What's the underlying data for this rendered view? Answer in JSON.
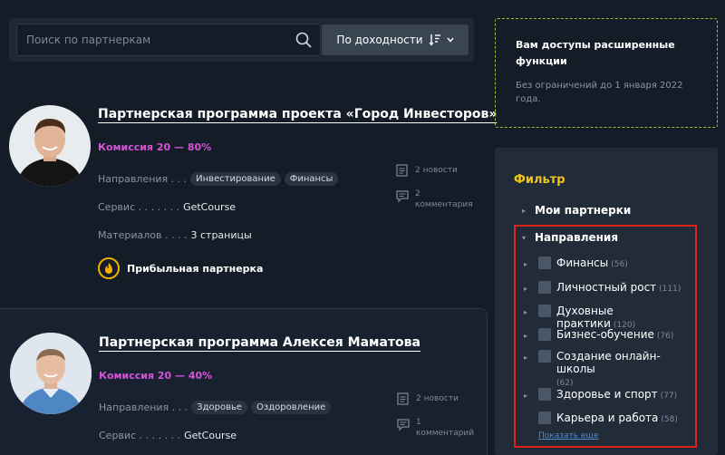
{
  "search": {
    "placeholder": "Поиск по партнеркам"
  },
  "sort": {
    "label": "По доходности"
  },
  "cards": [
    {
      "title": "Партнерская программа проекта «Город Инвесторов»",
      "commission": "Комиссия 20 — 80%",
      "directions_label": "Направления . . .",
      "tags": [
        "Инвестирование",
        "Финансы"
      ],
      "service_label": "Сервис . . . . . . .",
      "service_value": "GetCourse",
      "materials_label": "Материалов . . . .",
      "materials_value": "3 страницы",
      "badge": "Прибыльная партнерка",
      "news": "2 новости",
      "comments": "2 комментария"
    },
    {
      "title": "Партнерская программа Алексея Маматова",
      "commission": "Комиссия 20 — 40%",
      "directions_label": "Направления . . .",
      "tags": [
        "Здоровье",
        "Оздоровление"
      ],
      "service_label": "Сервис . . . . . . .",
      "service_value": "GetCourse",
      "news": "2 новости",
      "comments": "1 комментарий"
    }
  ],
  "promo": {
    "title": "Вам доступы расширенные функции",
    "text": "Без ограничений до 1 января 2022 года."
  },
  "filter": {
    "title": "Фильтр",
    "my_partners": "Мои партнерки",
    "directions": "Направления",
    "categories": [
      {
        "label": "Финансы",
        "count": "(56)"
      },
      {
        "label": "Личностный рост",
        "count": "(111)"
      },
      {
        "label": "Духовные практики",
        "count": "(120)"
      },
      {
        "label": "Бизнес-обучение",
        "count": "(76)"
      },
      {
        "label": "Создание онлайн-школы",
        "count": "(62)"
      },
      {
        "label": "Здоровье и спорт",
        "count": "(77)"
      },
      {
        "label": "Карьера и работа",
        "count": "(58)"
      }
    ],
    "show_more": "Показать еще"
  },
  "colors": {
    "accent_commission": "#d653d9",
    "accent_filter": "#f0c419",
    "highlight": "#e0201e"
  }
}
